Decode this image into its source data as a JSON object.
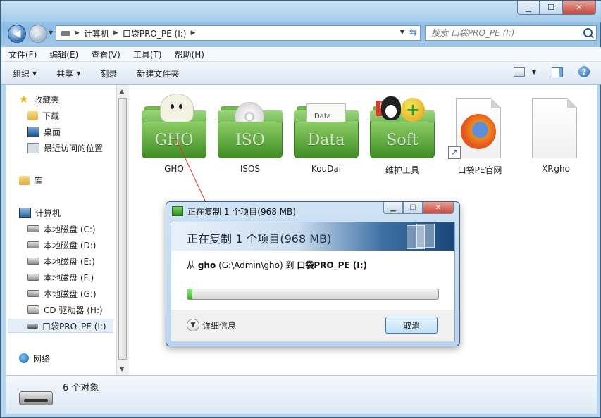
{
  "window": {
    "min_label": "▁",
    "max_label": "☐",
    "close_label": "✕"
  },
  "nav": {
    "back_label": "◀",
    "forward_label": "▶",
    "breadcrumbs": [
      "计算机",
      "口袋PRO_PE (I:)"
    ],
    "separator": "▶",
    "search_placeholder": "搜索 口袋PRO_PE (I:)"
  },
  "menubar": [
    "文件(F)",
    "编辑(E)",
    "查看(V)",
    "工具(T)",
    "帮助(H)"
  ],
  "toolbar": {
    "organize": "组织",
    "share": "共享",
    "burn": "刻录",
    "new_folder": "新建文件夹",
    "help_label": "?"
  },
  "sidebar": {
    "favorites_label": "收藏夹",
    "favorites": [
      "下载",
      "桌面",
      "最近访问的位置"
    ],
    "library_label": "库",
    "computer_label": "计算机",
    "drives": [
      "本地磁盘 (C:)",
      "本地磁盘 (D:)",
      "本地磁盘 (E:)",
      "本地磁盘 (F:)",
      "本地磁盘 (G:)",
      "CD 驱动器 (H:)",
      "口袋PRO_PE (I:)"
    ],
    "network_label": "网络"
  },
  "files": [
    {
      "name": "GHO",
      "folder_text": "GHO",
      "icon": "folder-ghost-icon"
    },
    {
      "name": "ISOS",
      "folder_text": "ISO",
      "icon": "folder-disc-icon"
    },
    {
      "name": "KouDai",
      "folder_text": "Data",
      "icon": "folder-data-icon"
    },
    {
      "name": "维护工具",
      "folder_text": "Soft",
      "icon": "folder-soft-icon"
    },
    {
      "name": "口袋PE官网",
      "icon": "firefox-shortcut-icon"
    },
    {
      "name": "XP.gho",
      "icon": "blank-file-icon"
    }
  ],
  "paper_label": "Data",
  "status": {
    "count": "6 个对象"
  },
  "dialog": {
    "title": "正在复制 1 个项目(968 MB)",
    "heading": "正在复制 1 个项目(968 MB)",
    "from_prefix": "从",
    "source_name": "gho",
    "source_path": "(G:\\Admin\\gho)",
    "to_word": "到",
    "dest_name": "口袋PRO_PE (I:)",
    "progress_fraction": 0.02,
    "details_label": "详细信息",
    "cancel_label": "取消"
  }
}
